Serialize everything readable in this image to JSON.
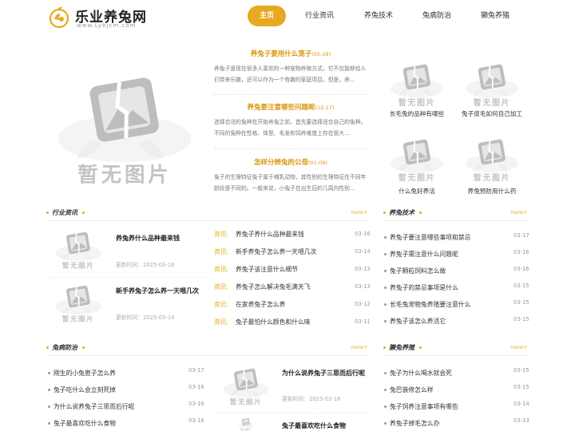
{
  "header": {
    "site_title": "乐业养兔网",
    "site_domain": "www.Lybjcm.com",
    "nav": [
      "主页",
      "行业资讯",
      "养兔技术",
      "兔病防治",
      "獭兔养殖"
    ]
  },
  "placeholder_text": "暂无图片",
  "featured": [
    {
      "title": "养兔子要用什么笼子",
      "date": "(05-28)",
      "text": "养兔子是现在很多人喜欢的一种宠物养殖方式。它不仅能够给人们带来乐趣，还可以作为一个有趣的家庭项目。但是，养..."
    },
    {
      "title": "养兔要注意哪些问题呢",
      "date": "(12-17)",
      "text": "选择合适的兔种在开始养兔之前，首先要选择适合自己的兔种。不同的兔种在性格、体型、毛发和饲养难度上存在很大..."
    },
    {
      "title": "怎样分辨兔的公母",
      "date": "(01-09)",
      "text": "兔子的生理特征兔子属于哺乳动物，其性别的生理特征在不同年龄段是不同的。一般来说，小兔子在出生后的几周内性别..."
    }
  ],
  "grid": [
    "长毛兔的品种有哪些",
    "兔子皮毛如何自己加工",
    "什么兔好养活",
    "养兔预防用什么药"
  ],
  "industry": {
    "label": "行业资讯",
    "more": "more+",
    "articles": [
      {
        "title": "养兔养什么品种最来钱",
        "date": "更新时间：2025-03-16"
      },
      {
        "title": "新手养兔子怎么养一天喂几次",
        "date": "更新时间：2025-03-14"
      }
    ],
    "list": [
      {
        "tag": "资讯:",
        "title": "养兔子养什么品种最来钱",
        "date": "03-16"
      },
      {
        "tag": "资讯:",
        "title": "新手养兔子怎么养一天喂几次",
        "date": "03-14"
      },
      {
        "tag": "资讯:",
        "title": "养兔子该注意什么细节",
        "date": "03-13"
      },
      {
        "tag": "资讯:",
        "title": "养兔子怎么解决兔毛满天飞",
        "date": "03-13"
      },
      {
        "tag": "资讯:",
        "title": "在家养兔子怎么养",
        "date": "03-12"
      },
      {
        "tag": "资讯:",
        "title": "兔子最怕什么颜色和什么味",
        "date": "03-11"
      }
    ]
  },
  "tech": {
    "label": "养兔技术",
    "more": "more+",
    "list": [
      {
        "title": "养兔子要注意哪些事项和禁忌",
        "date": "03-17"
      },
      {
        "title": "养兔子需注意什么问题呢",
        "date": "03-16"
      },
      {
        "title": "兔子颗粒饲料怎么做",
        "date": "03-16"
      },
      {
        "title": "养兔子的禁忌事项是什么",
        "date": "03-15"
      },
      {
        "title": "长毛兔宠物兔养殖要注意什么",
        "date": "03-15"
      },
      {
        "title": "养兔子该怎么养活它",
        "date": "03-15"
      }
    ]
  },
  "disease": {
    "label": "兔病防治",
    "more": "more+",
    "list": [
      {
        "title": "刚生的小兔崽子怎么养",
        "date": "03-17"
      },
      {
        "title": "兔子吃什么会立刻死掉",
        "date": "03-16"
      },
      {
        "title": "为什么说养兔子三思而后行呢",
        "date": "03-16"
      },
      {
        "title": "兔子最喜欢吃什么食物",
        "date": "03-16"
      }
    ],
    "articles": [
      {
        "title": "为什么说养兔子三思而后行呢",
        "date": "更新时间：2025-03-16"
      },
      {
        "title": "兔子最喜欢吃什么食物",
        "date": ""
      }
    ]
  },
  "otter": {
    "label": "獭兔养殖",
    "more": "more+",
    "list": [
      {
        "title": "兔子为什么喝水就会死",
        "date": "03-15"
      },
      {
        "title": "兔巴装修怎么样",
        "date": "03-15"
      },
      {
        "title": "兔子饲养注意事项有哪些",
        "date": "03-14"
      },
      {
        "title": "养兔子掉毛怎么办",
        "date": "03-13"
      }
    ]
  }
}
